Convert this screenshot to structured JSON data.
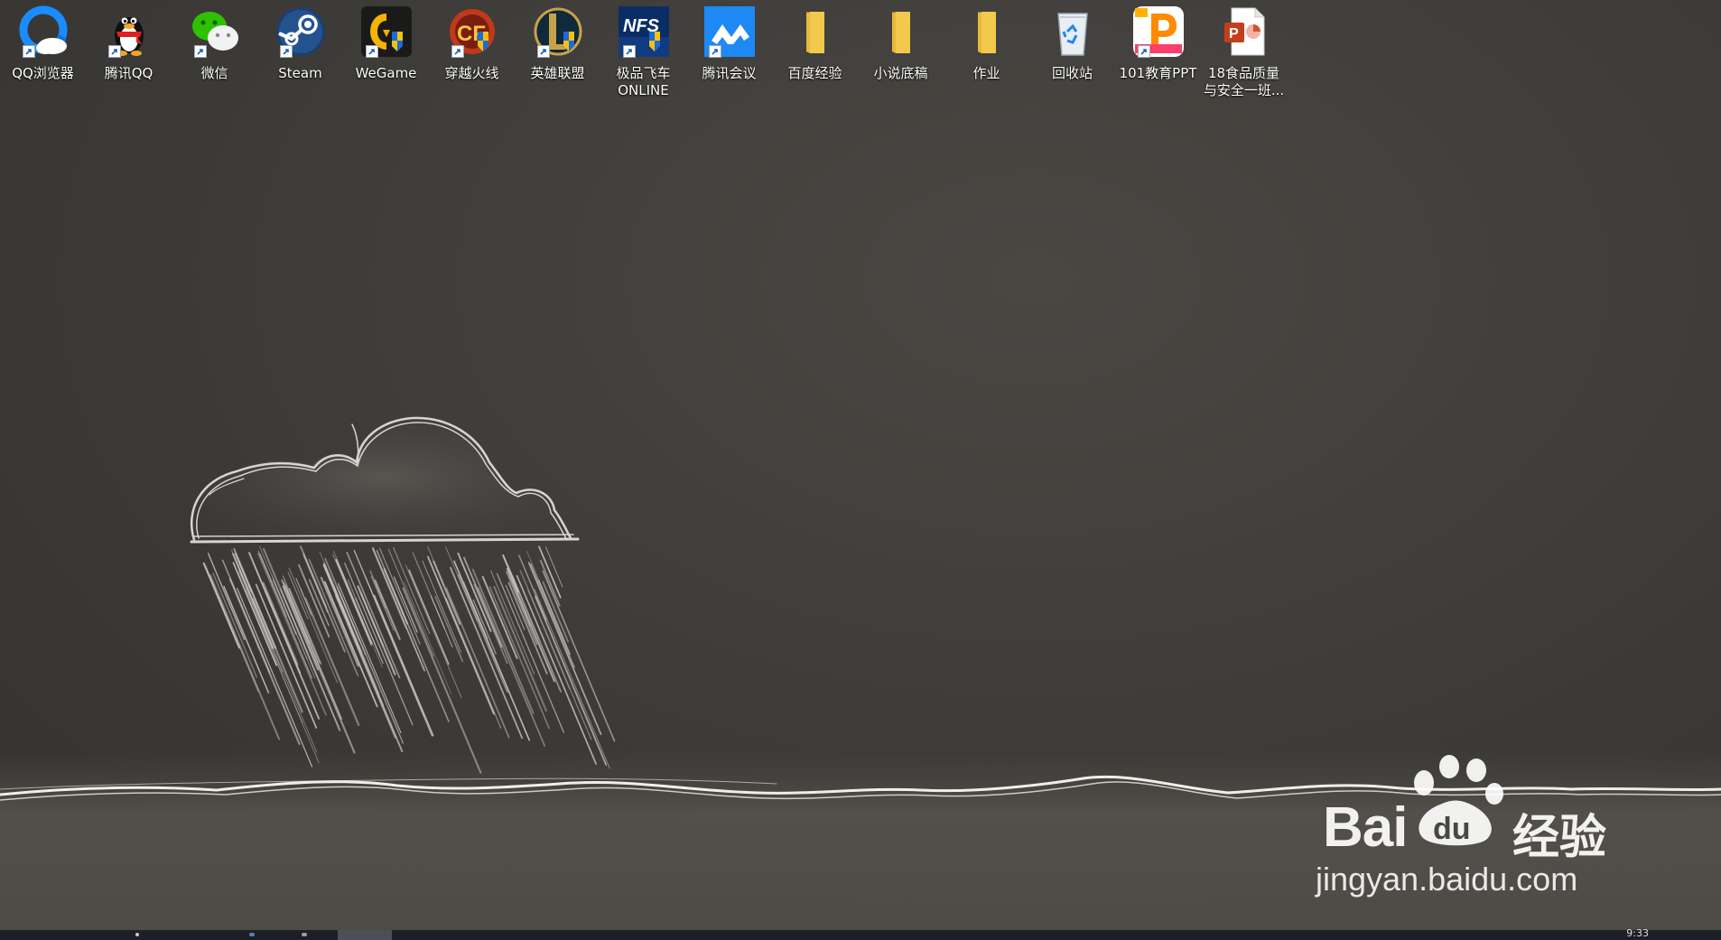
{
  "desktop_icons": [
    {
      "label": "QQ浏览器",
      "icon": "qq-browser-icon"
    },
    {
      "label": "腾讯QQ",
      "icon": "tencent-qq-penguin-icon"
    },
    {
      "label": "微信",
      "icon": "wechat-icon"
    },
    {
      "label": "Steam",
      "icon": "steam-icon"
    },
    {
      "label": "WeGame",
      "icon": "wegame-icon"
    },
    {
      "label": "穿越火线",
      "icon": "crossfire-icon"
    },
    {
      "label": "英雄联盟",
      "icon": "league-of-legends-icon"
    },
    {
      "label": "极品飞车\nONLINE",
      "icon": "nfs-online-icon"
    },
    {
      "label": "腾讯会议",
      "icon": "tencent-meeting-icon"
    },
    {
      "label": "百度经验",
      "icon": "folder-icon"
    },
    {
      "label": "小说底稿",
      "icon": "folder-icon"
    },
    {
      "label": "作业",
      "icon": "folder-icon"
    },
    {
      "label": "回收站",
      "icon": "recycle-bin-icon"
    },
    {
      "label": "101教育PPT",
      "icon": "education-ppt-icon"
    },
    {
      "label": "18食品质量\n与安全一班...",
      "icon": "powerpoint-file-icon"
    }
  ],
  "watermark": {
    "brand_prefix": "Bai",
    "brand_suffix": "经验",
    "paw_text": "du",
    "url": "jingyan.baidu.com"
  },
  "taskbar": {
    "clock": "9:33"
  },
  "colors": {
    "wallpaper": "#3d3b38",
    "taskbar": "#1b1f27",
    "folder_yellow": "#f2c94c",
    "qq_blue": "#1a8cff",
    "wechat_green": "#2dc100"
  }
}
